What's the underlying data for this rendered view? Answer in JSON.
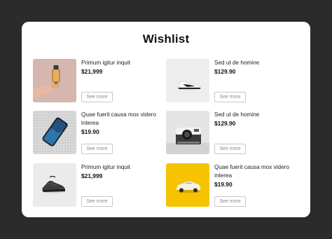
{
  "wishlist": {
    "title": "Wishlist",
    "see_more_label": "See more",
    "items": [
      {
        "name": "Primum igitur inquit",
        "price": "$21,999",
        "image": "perfume-bottle-hand",
        "bg": "#d7bcb6"
      },
      {
        "name": "Sed ut de homine",
        "price": "$129.90",
        "image": "sneaker-shoe",
        "bg": "#ececec"
      },
      {
        "name": "Quae fuerit causa mox videro interea",
        "price": "$19.90",
        "image": "smartphone",
        "bg": "#d8d8d8"
      },
      {
        "name": "Sed ut de homine",
        "price": "$129.90",
        "image": "instant-camera",
        "bg": "#e2e2e2"
      },
      {
        "name": "Primum igitur inquit",
        "price": "$21,999",
        "image": "running-shoe",
        "bg": "#e9e9e9"
      },
      {
        "name": "Quae fuerit causa mox videro interea",
        "price": "$19.90",
        "image": "toy-car",
        "bg": "#f6c200"
      }
    ]
  }
}
